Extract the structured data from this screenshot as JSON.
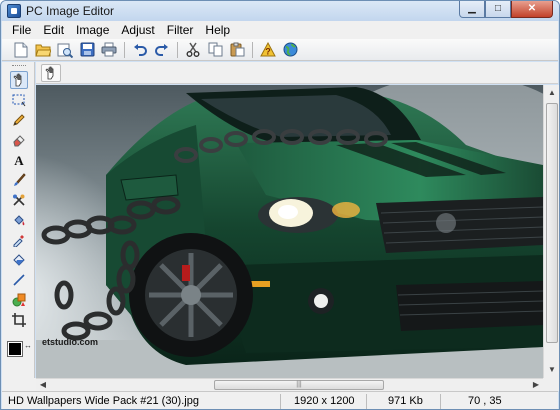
{
  "window": {
    "title": "PC Image Editor"
  },
  "menu": [
    "File",
    "Edit",
    "Image",
    "Adjust",
    "Filter",
    "Help"
  ],
  "toolbar": {
    "buttons": [
      "new-icon",
      "open-icon",
      "browse-icon",
      "save-icon",
      "print-icon",
      "undo-icon",
      "redo-icon",
      "cut-icon",
      "copy-icon",
      "paste-icon",
      "help-icon",
      "web-icon"
    ]
  },
  "tools": [
    "hand",
    "select",
    "pencil",
    "eraser",
    "text",
    "brush",
    "clone",
    "fill",
    "eyedropper",
    "paint-bucket",
    "line",
    "shapes",
    "crop"
  ],
  "canvas": {
    "watermark_text": "etstudio.com"
  },
  "status": {
    "filename": "HD Wallpapers Wide Pack #21 (30).jpg",
    "dimensions": "1920 x 1200",
    "filesize": "971 Kb",
    "cursor": "70 , 35"
  },
  "colors": {
    "accent": "#dbe8f8",
    "foreground": "#000000",
    "background": "#ffffff"
  }
}
